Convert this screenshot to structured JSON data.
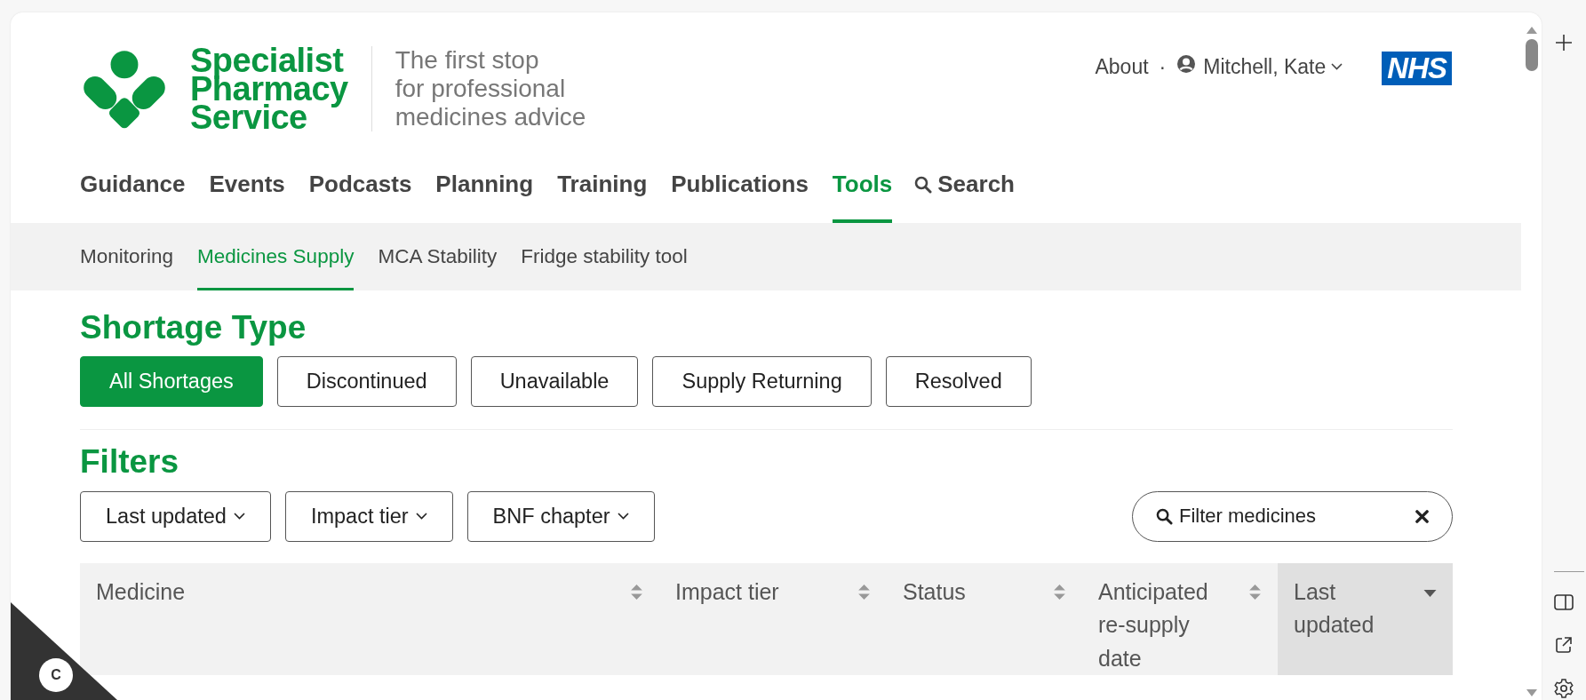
{
  "site": {
    "name_lines": [
      "Specialist",
      "Pharmacy",
      "Service"
    ],
    "tagline_lines": [
      "The first stop",
      "for professional",
      "medicines advice"
    ]
  },
  "top_links": {
    "about": "About",
    "separator": "·",
    "user": "Mitchell, Kate"
  },
  "nhs_logo": "NHS",
  "nav": [
    {
      "label": "Guidance",
      "selected": false
    },
    {
      "label": "Events",
      "selected": false
    },
    {
      "label": "Podcasts",
      "selected": false
    },
    {
      "label": "Planning",
      "selected": false
    },
    {
      "label": "Training",
      "selected": false
    },
    {
      "label": "Publications",
      "selected": false
    },
    {
      "label": "Tools",
      "selected": true
    }
  ],
  "nav_search": "Search",
  "subnav": [
    {
      "label": "Monitoring",
      "selected": false
    },
    {
      "label": "Medicines Supply",
      "selected": true
    },
    {
      "label": "MCA Stability",
      "selected": false
    },
    {
      "label": "Fridge stability tool",
      "selected": false
    }
  ],
  "shortage_type": {
    "heading": "Shortage Type",
    "options": [
      {
        "label": "All Shortages",
        "selected": true
      },
      {
        "label": "Discontinued",
        "selected": false
      },
      {
        "label": "Unavailable",
        "selected": false
      },
      {
        "label": "Supply Returning",
        "selected": false
      },
      {
        "label": "Resolved",
        "selected": false
      }
    ]
  },
  "filters": {
    "heading": "Filters",
    "dropdowns": [
      "Last updated",
      "Impact tier",
      "BNF chapter"
    ],
    "search": {
      "placeholder": "Filter medicines"
    }
  },
  "table": {
    "columns": [
      {
        "label": "Medicine",
        "sorted": false
      },
      {
        "label": "Impact tier",
        "sorted": false
      },
      {
        "label": "Status",
        "sorted": false
      },
      {
        "label": "Anticipated re-supply date",
        "sorted": false
      },
      {
        "label": "Last updated",
        "sorted": true
      }
    ]
  },
  "cookie_badge": "C"
}
